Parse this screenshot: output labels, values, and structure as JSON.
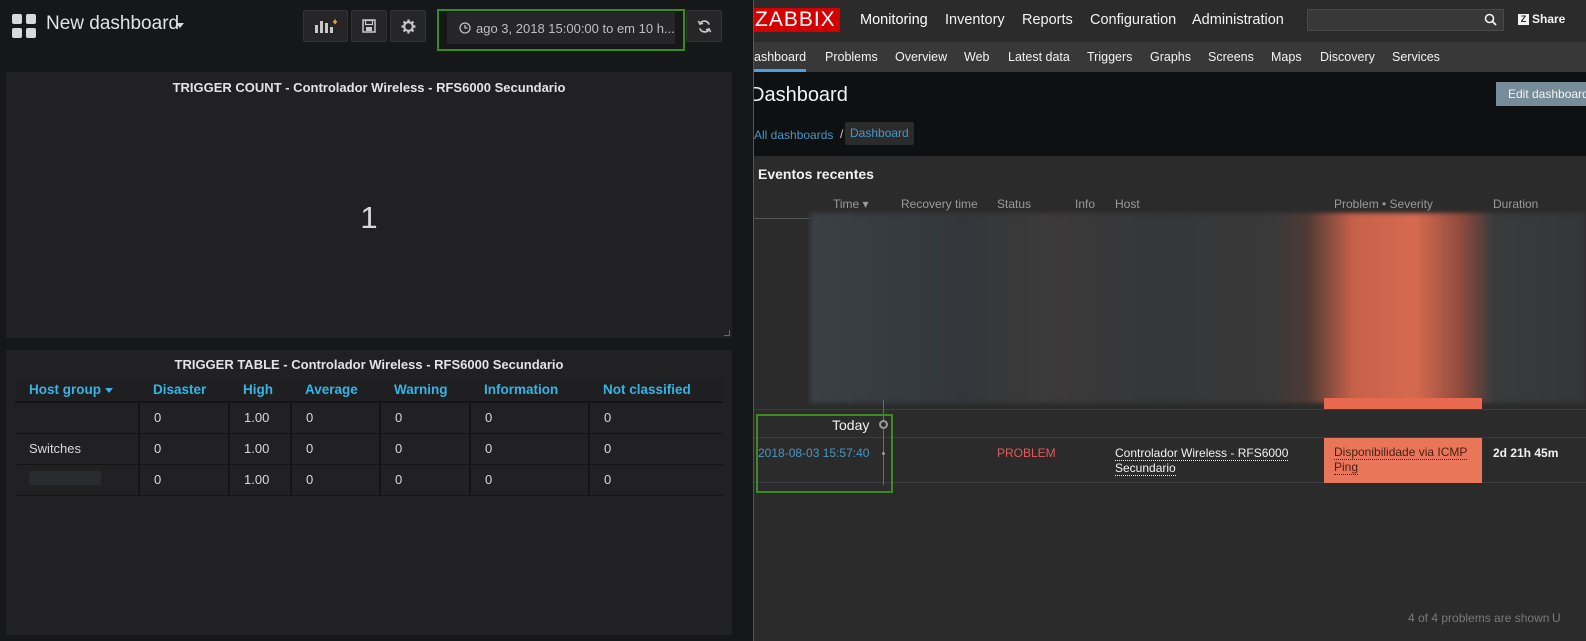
{
  "grafana": {
    "dashboard_title": "New dashboard",
    "time_range": "ago 3, 2018 15:00:00 to em 10 h...",
    "panel1": {
      "title": "TRIGGER COUNT - Controlador Wireless - RFS6000 Secundario",
      "value": "1"
    },
    "panel2": {
      "title": "TRIGGER TABLE - Controlador Wireless - RFS6000 Secundario",
      "columns": [
        "Host group",
        "Disaster",
        "High",
        "Average",
        "Warning",
        "Information",
        "Not classified"
      ],
      "rows": [
        [
          "",
          "0",
          "1.00",
          "0",
          "0",
          "0",
          "0"
        ],
        [
          "Switches",
          "0",
          "1.00",
          "0",
          "0",
          "0",
          "0"
        ],
        [
          "",
          "0",
          "1.00",
          "0",
          "0",
          "0",
          "0"
        ]
      ]
    }
  },
  "zabbix": {
    "logo": "ZABBIX",
    "menu": [
      "Monitoring",
      "Inventory",
      "Reports",
      "Configuration",
      "Administration"
    ],
    "share": "Share",
    "submenu": [
      "ashboard",
      "Problems",
      "Overview",
      "Web",
      "Latest data",
      "Triggers",
      "Graphs",
      "Screens",
      "Maps",
      "Discovery",
      "Services"
    ],
    "page_title": "Dashboard",
    "edit_button": "Edit dashboard",
    "breadcrumb": {
      "all": "All dashboards",
      "sep": "/",
      "current": "Dashboard"
    },
    "widget_title": "Eventos recentes",
    "columns": [
      "Time ▾",
      "Recovery time",
      "Status",
      "Info",
      "Host",
      "Problem • Severity",
      "Duration"
    ],
    "today_label": "Today",
    "event": {
      "time": "2018-08-03 15:57:40",
      "status": "PROBLEM",
      "host": "Controlador Wireless - RFS6000 Secundario",
      "problem": "Disponibilidade via ICMP Ping",
      "duration": "2d 21h 45m"
    },
    "footer": "4 of 4 problems are shown",
    "footer_cut": "U",
    "colors": {
      "logo_bg": "#d40000",
      "problem_bg": "#e97659",
      "status_red": "#e45959",
      "link": "#4796c4",
      "highlight": "#3c8b1f"
    }
  }
}
